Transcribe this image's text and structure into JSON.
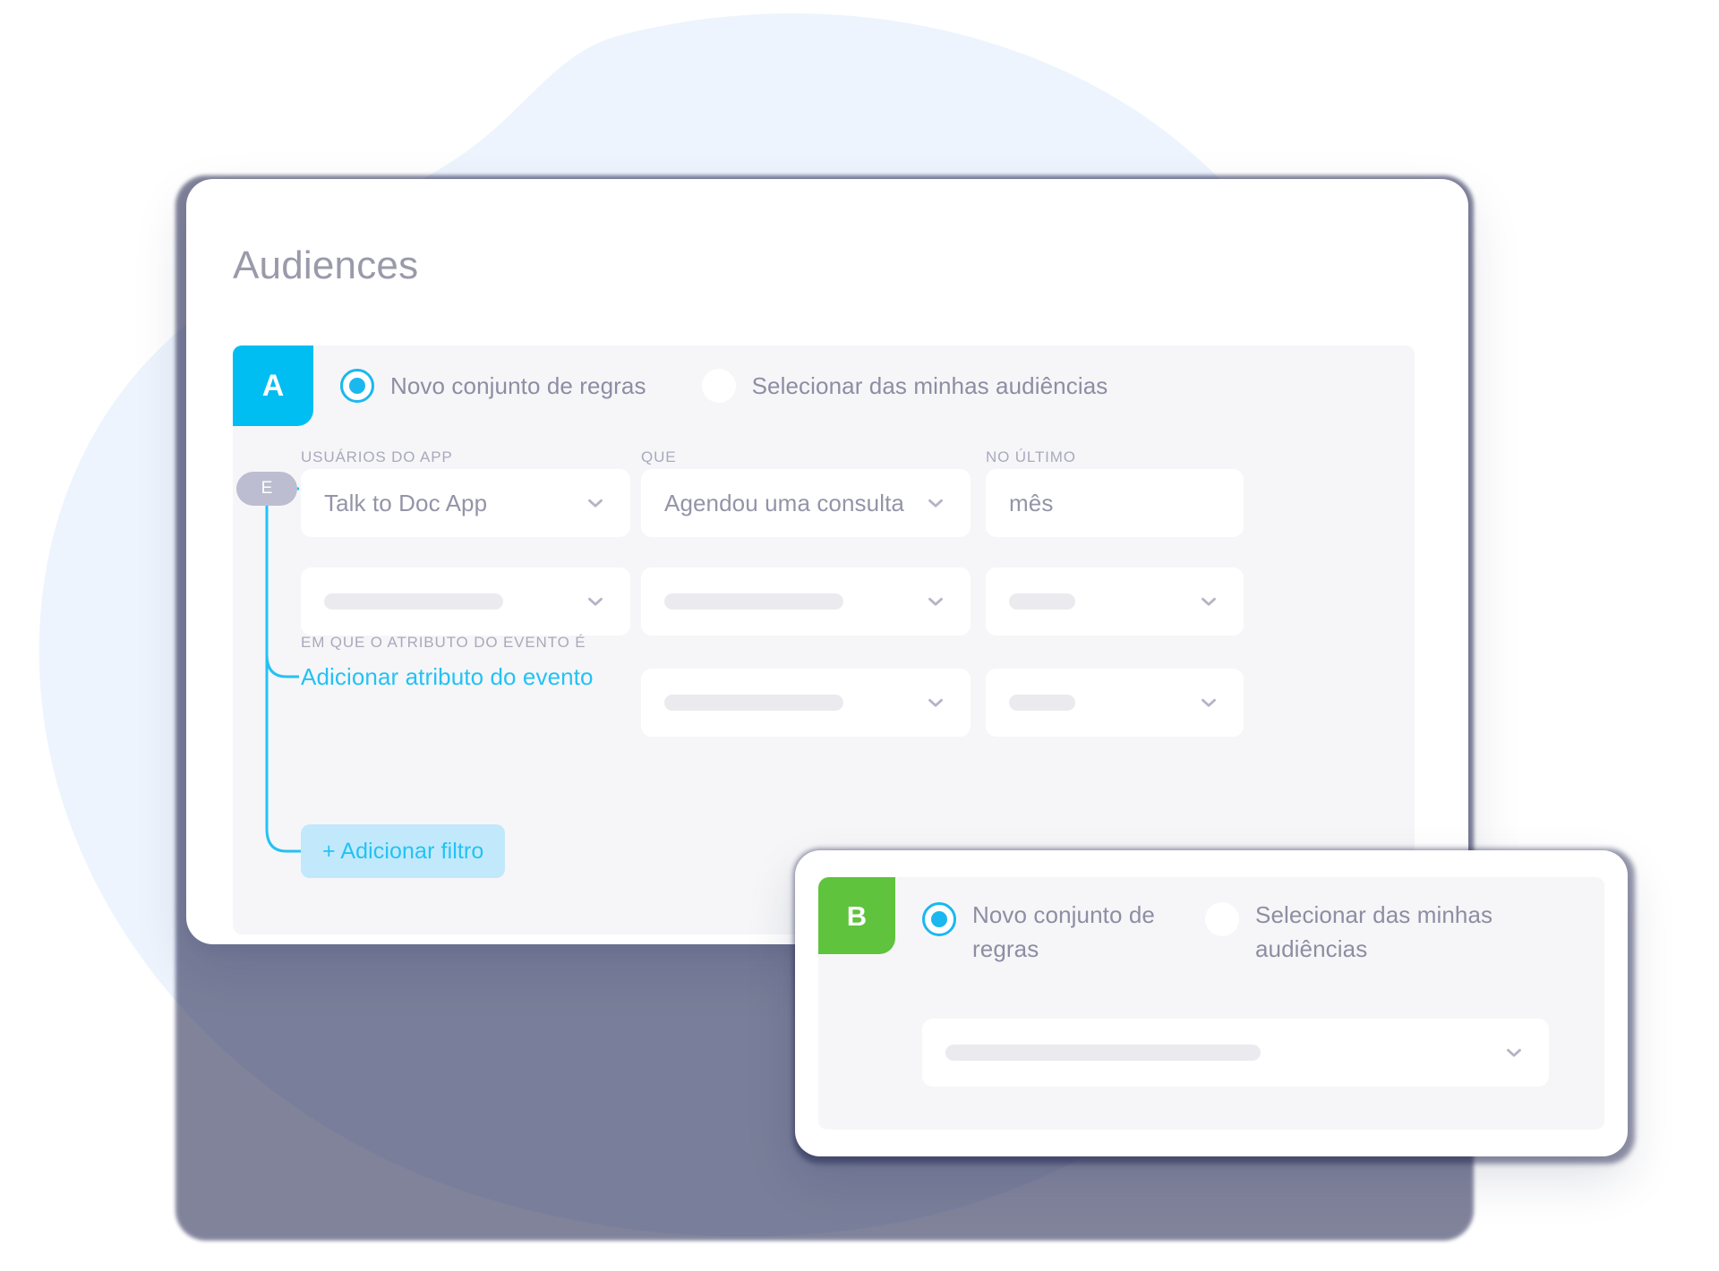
{
  "page": {
    "title": "Audiences"
  },
  "colors": {
    "badge_a": "#00bdf2",
    "badge_b": "#5fc33d",
    "accent_cyan": "#23c2f5",
    "radio_on": "#1ab8ef",
    "connector_line": "#23c2f5",
    "add_filter_bg": "#c2e9fb",
    "e_badge_bg": "#bdbdd1",
    "panel_bg": "#f6f6f8",
    "card_bg": "#ffffff",
    "title_text": "#9a9aab",
    "label_text": "#a9a9bd",
    "value_text": "#9494a8",
    "blob_bg": "#edf4fd",
    "shadow_smudge": "#1b1f4b"
  },
  "group_a": {
    "badge_letter": "A",
    "options": [
      {
        "label": "Novo conjunto de regras",
        "selected": true
      },
      {
        "label": "Selecionar das minhas audiências",
        "selected": false
      }
    ],
    "connector_badge": "E",
    "labels": {
      "col1": "USUÁRIOS DO APP",
      "col2": "QUE",
      "col3": "NO ÚLTIMO",
      "attribute": "EM QUE O ATRIBUTO DO EVENTO É"
    },
    "row1": {
      "app": "Talk to Doc App",
      "event": "Agendou uma consulta",
      "period": "mês"
    },
    "row2": {
      "app": "",
      "event": "",
      "period": ""
    },
    "attribute_row": {
      "link": "Adicionar atributo do evento",
      "operator": "",
      "value": ""
    },
    "add_filter_label": "+ Adicionar filtro"
  },
  "group_b": {
    "badge_letter": "B",
    "options": [
      {
        "label": "Novo conjunto de regras",
        "selected": true
      },
      {
        "label": "Selecionar das minhas audiências",
        "selected": false
      }
    ],
    "audience_select": ""
  },
  "icons": {
    "chevron_down": "chevron-down-icon",
    "radio_selected": "radio-selected-icon",
    "radio_unselected": "radio-unselected-icon",
    "plus": "plus-icon"
  }
}
